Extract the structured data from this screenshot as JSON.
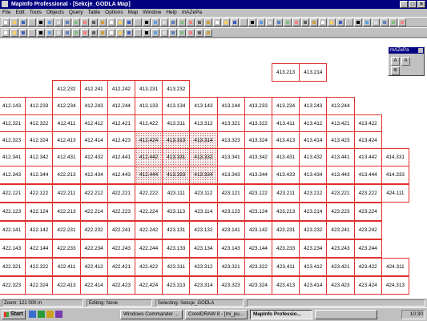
{
  "window": {
    "title": "MapInfo Professional - [Sekcje_GODLA Map]",
    "btn_min": "_",
    "btn_max": "□",
    "btn_close": "×"
  },
  "menu": [
    "File",
    "Edit",
    "Tools",
    "Objects",
    "Query",
    "Table",
    "Options",
    "Map",
    "Window",
    "Help",
    "mAZePa"
  ],
  "palette": {
    "title": "mAZePa",
    "btn_a": "A",
    "btn_b": "A",
    "btn_c": "⊛"
  },
  "status": {
    "zoom": "Zoom: 121 000 m",
    "editing": "Editing: None",
    "selecting": "Selecting: Sekcje_GODLA"
  },
  "taskbar": {
    "start": "Start",
    "tasks": [
      "Windows Commander ...",
      "CorelDRAW 8 - [mi_pu...",
      "MapInfo Professio...",
      ""
    ],
    "clock": "10:30"
  },
  "colors": {
    "grid_line": "#e03030",
    "selection_fill": "#c86060",
    "title_bar": "#000080"
  },
  "map": {
    "rows": [
      {
        "cells": [
          "413.213",
          "413.214"
        ]
      },
      {
        "cells": [
          "412.232",
          "412.241",
          "412.242",
          "413.231",
          "413.232"
        ]
      },
      {
        "cells": [
          "412.143",
          "412.233",
          "412.234",
          "412.243",
          "412.244",
          "413.133",
          "413.134",
          "413.143",
          "413.144",
          "413.233",
          "413.234",
          "413.243",
          "413.244"
        ]
      },
      {
        "cells": [
          "412.321",
          "412.322",
          "412.411",
          "412.412",
          "412.421",
          "412.422",
          "413.311",
          "413.312",
          "413.321",
          "413.322",
          "413.411",
          "413.412",
          "413.421",
          "413.422"
        ]
      },
      {
        "cells": [
          "412.323",
          "412.324",
          "412.413",
          "412.414",
          "412.423",
          "412.424",
          "413.313",
          "413.314",
          "413.323",
          "413.324",
          "413.413",
          "413.414",
          "413.423",
          "413.424"
        ]
      },
      {
        "cells": [
          "412.341",
          "412.342",
          "412.431",
          "412.432",
          "412.441",
          "412.442",
          "413.331",
          "413.332",
          "413.341",
          "413.342",
          "413.431",
          "413.432",
          "413.441",
          "413.442",
          "414.331"
        ]
      },
      {
        "cells": [
          "412.343",
          "412.344",
          "422.213",
          "412.434",
          "412.443",
          "412.444",
          "413.333",
          "413.334",
          "413.343",
          "413.344",
          "413.433",
          "413.434",
          "413.443",
          "413.444",
          "414.333"
        ]
      },
      {
        "cells": [
          "422.121",
          "422.122",
          "422.211",
          "422.212",
          "422.221",
          "422.222",
          "423.111",
          "423.112",
          "423.121",
          "423.122",
          "423.211",
          "423.212",
          "423.221",
          "423.222",
          "424.111"
        ]
      },
      {
        "cells": [
          "422.123",
          "422.124",
          "422.213",
          "422.214",
          "422.223",
          "422.224",
          "423.113",
          "423.114",
          "423.123",
          "423.124",
          "423.213",
          "423.214",
          "423.223",
          "423.224"
        ]
      },
      {
        "cells": [
          "422.141",
          "422.142",
          "422.231",
          "422.232",
          "422.241",
          "422.242",
          "423.131",
          "423.132",
          "423.141",
          "423.142",
          "423.231",
          "423.232",
          "423.241",
          "423.242"
        ]
      },
      {
        "cells": [
          "422.143",
          "422.144",
          "422.233",
          "422.234",
          "422.243",
          "422.244",
          "423.133",
          "423.134",
          "423.143",
          "423.144",
          "423.233",
          "423.234",
          "423.243",
          "423.244"
        ]
      },
      {
        "cells": [
          "422.321",
          "422.322",
          "422.411",
          "422.412",
          "422.421",
          "422.422",
          "423.311",
          "423.312",
          "423.321",
          "423.322",
          "423.411",
          "423.412",
          "423.421",
          "423.422",
          "424.311"
        ]
      },
      {
        "cells": [
          "422.323",
          "422.324",
          "422.413",
          "422.414",
          "422.423",
          "422.424",
          "423.313",
          "423.314",
          "423.323",
          "423.324",
          "423.413",
          "423.414",
          "423.423",
          "423.424",
          "424.313"
        ]
      }
    ]
  }
}
